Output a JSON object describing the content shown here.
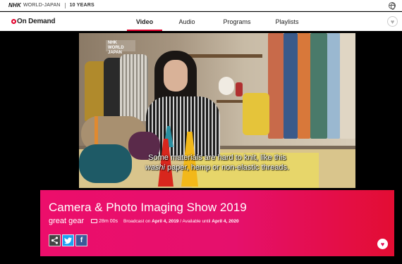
{
  "topbar": {
    "brand_nhk": "NHK",
    "brand_name": "WORLD-JAPAN",
    "brand_years": "10 YEARS",
    "globe_icon": "globe-icon"
  },
  "navbar": {
    "logo_text": "On Demand",
    "items": [
      {
        "label": "Video",
        "active": true
      },
      {
        "label": "Audio",
        "active": false
      },
      {
        "label": "Programs",
        "active": false
      },
      {
        "label": "Playlists",
        "active": false
      }
    ],
    "favorite_icon": "heart-icon"
  },
  "player": {
    "watermark": "NHK WORLD JAPAN",
    "subtitle_line1": "Some materials are hard to knit, like this",
    "subtitle_line2_em": "washi",
    "subtitle_line2_rest": " paper, hemp or non-elastic threads."
  },
  "episode": {
    "title": "Camera & Photo Imaging Show 2019",
    "series": "great gear",
    "duration": "28m 00s",
    "broadcast_prefix": "Broadcast on ",
    "broadcast_date": "April 4, 2019",
    "available_prefix": " / Available until ",
    "available_date": "April 4, 2020",
    "share_icons": [
      "share-icon",
      "twitter-icon",
      "facebook-icon"
    ],
    "favorite_icon": "heart-icon"
  },
  "colors": {
    "accent": "#e3002b",
    "info_bg_start": "#ec0e6b",
    "info_bg_end": "#e30d33",
    "twitter": "#1da1f2",
    "facebook": "#3b5998"
  }
}
